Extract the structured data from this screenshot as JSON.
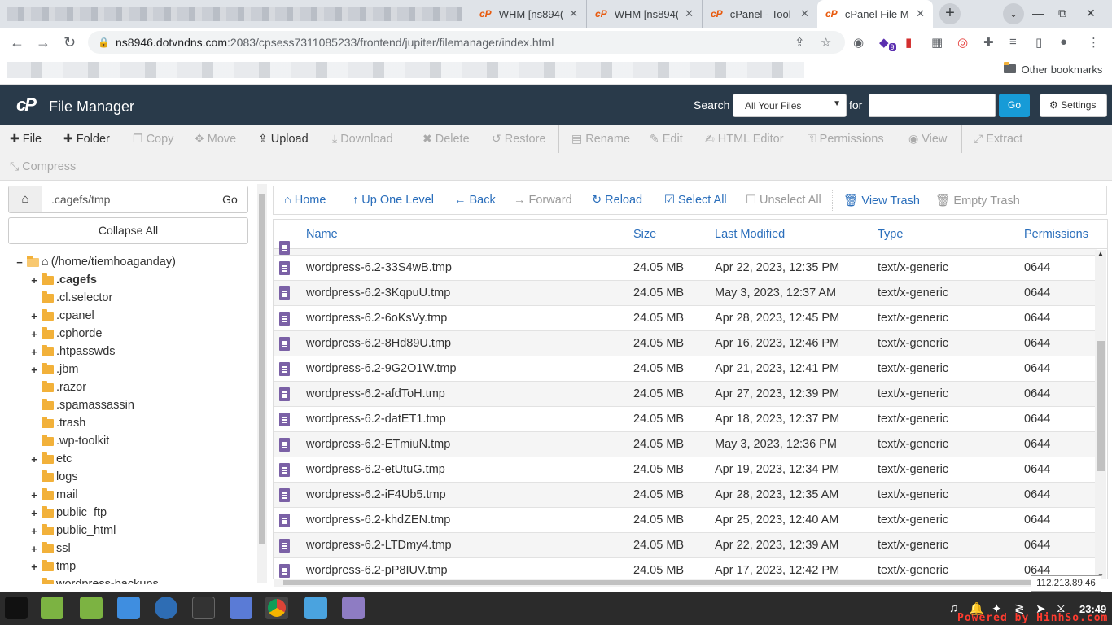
{
  "browser": {
    "tabs": [
      {
        "label": "WHM [ns894(",
        "active": false
      },
      {
        "label": "WHM [ns894(",
        "active": false
      },
      {
        "label": "cPanel - Tool",
        "active": false
      },
      {
        "label": "cPanel File M",
        "active": true
      }
    ],
    "url_host": "ns8946.dotvndns.com",
    "url_path": ":2083/cpsess7311085233/frontend/jupiter/filemanager/index.html",
    "other_bookmarks": "Other bookmarks",
    "ext_badge": "9"
  },
  "header": {
    "logo": "cP",
    "title": "File Manager",
    "search_label": "Search",
    "search_scope": "All Your Files",
    "for_label": "for",
    "go": "Go",
    "settings": "Settings"
  },
  "toolbar": {
    "file": "File",
    "folder": "Folder",
    "copy": "Copy",
    "move": "Move",
    "upload": "Upload",
    "download": "Download",
    "delete": "Delete",
    "restore": "Restore",
    "rename": "Rename",
    "edit": "Edit",
    "html_editor": "HTML Editor",
    "permissions": "Permissions",
    "view": "View",
    "extract": "Extract",
    "compress": "Compress"
  },
  "left": {
    "path": ".cagefs/tmp",
    "go": "Go",
    "collapse_all": "Collapse All",
    "root": "(/home/tiemhoaganday)",
    "tree": [
      {
        "name": ".cagefs",
        "exp": "+",
        "bold": true
      },
      {
        "name": ".cl.selector",
        "exp": ""
      },
      {
        "name": ".cpanel",
        "exp": "+"
      },
      {
        "name": ".cphorde",
        "exp": "+"
      },
      {
        "name": ".htpasswds",
        "exp": "+"
      },
      {
        "name": ".jbm",
        "exp": "+"
      },
      {
        "name": ".razor",
        "exp": ""
      },
      {
        "name": ".spamassassin",
        "exp": ""
      },
      {
        "name": ".trash",
        "exp": ""
      },
      {
        "name": ".wp-toolkit",
        "exp": ""
      },
      {
        "name": "etc",
        "exp": "+"
      },
      {
        "name": "logs",
        "exp": ""
      },
      {
        "name": "mail",
        "exp": "+"
      },
      {
        "name": "public_ftp",
        "exp": "+"
      },
      {
        "name": "public_html",
        "exp": "+"
      },
      {
        "name": "ssl",
        "exp": "+"
      },
      {
        "name": "tmp",
        "exp": "+"
      },
      {
        "name": "wordpress-backups",
        "exp": ""
      }
    ]
  },
  "nav": {
    "home": "Home",
    "up": "Up One Level",
    "back": "Back",
    "forward": "Forward",
    "reload": "Reload",
    "select_all": "Select All",
    "unselect_all": "Unselect All",
    "view_trash": "View Trash",
    "empty_trash": "Empty Trash"
  },
  "table": {
    "headers": [
      "Name",
      "Size",
      "Last Modified",
      "Type",
      "Permissions"
    ],
    "rows": [
      [
        "wordpress-6.2-33S4wB.tmp",
        "24.05 MB",
        "Apr 22, 2023, 12:35 PM",
        "text/x-generic",
        "0644"
      ],
      [
        "wordpress-6.2-3KqpuU.tmp",
        "24.05 MB",
        "May 3, 2023, 12:37 AM",
        "text/x-generic",
        "0644"
      ],
      [
        "wordpress-6.2-6oKsVy.tmp",
        "24.05 MB",
        "Apr 28, 2023, 12:45 PM",
        "text/x-generic",
        "0644"
      ],
      [
        "wordpress-6.2-8Hd89U.tmp",
        "24.05 MB",
        "Apr 16, 2023, 12:46 PM",
        "text/x-generic",
        "0644"
      ],
      [
        "wordpress-6.2-9G2O1W.tmp",
        "24.05 MB",
        "Apr 21, 2023, 12:41 PM",
        "text/x-generic",
        "0644"
      ],
      [
        "wordpress-6.2-afdToH.tmp",
        "24.05 MB",
        "Apr 27, 2023, 12:39 PM",
        "text/x-generic",
        "0644"
      ],
      [
        "wordpress-6.2-datET1.tmp",
        "24.05 MB",
        "Apr 18, 2023, 12:37 PM",
        "text/x-generic",
        "0644"
      ],
      [
        "wordpress-6.2-ETmiuN.tmp",
        "24.05 MB",
        "May 3, 2023, 12:36 PM",
        "text/x-generic",
        "0644"
      ],
      [
        "wordpress-6.2-etUtuG.tmp",
        "24.05 MB",
        "Apr 19, 2023, 12:34 PM",
        "text/x-generic",
        "0644"
      ],
      [
        "wordpress-6.2-iF4Ub5.tmp",
        "24.05 MB",
        "Apr 28, 2023, 12:35 AM",
        "text/x-generic",
        "0644"
      ],
      [
        "wordpress-6.2-khdZEN.tmp",
        "24.05 MB",
        "Apr 25, 2023, 12:40 AM",
        "text/x-generic",
        "0644"
      ],
      [
        "wordpress-6.2-LTDmy4.tmp",
        "24.05 MB",
        "Apr 22, 2023, 12:39 AM",
        "text/x-generic",
        "0644"
      ],
      [
        "wordpress-6.2-pP8IUV.tmp",
        "24.05 MB",
        "Apr 17, 2023, 12:42 PM",
        "text/x-generic",
        "0644"
      ]
    ]
  },
  "ip_tooltip": "112.213.89.46",
  "taskbar": {
    "clock": "23:49"
  },
  "watermark": "Powered by HinhSo.com",
  "colors": {
    "header_bg": "#293a4a",
    "link": "#2a6ebb",
    "go_button": "#179bd7",
    "file_icon": "#7b61a6",
    "folder": "#f2b13a"
  }
}
